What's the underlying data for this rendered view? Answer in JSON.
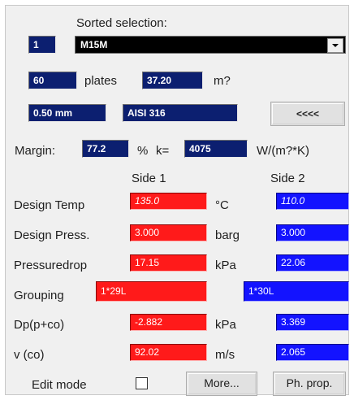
{
  "header": {
    "sorted_selection_label": "Sorted selection:"
  },
  "selection": {
    "index": "1",
    "model": "M15M"
  },
  "plates": {
    "count": "60",
    "label": "plates",
    "area": "37.20",
    "area_unit": "m?"
  },
  "material": {
    "thickness": "0.50 mm",
    "name": "AISI 316",
    "collapse_button": "<<<<"
  },
  "margin": {
    "label": "Margin:",
    "value": "77.2",
    "unit": "%",
    "k_label": "k=",
    "k_value": "4075",
    "k_unit": "W/(m?*K)"
  },
  "columns": {
    "side1": "Side 1",
    "side2": "Side 2"
  },
  "rows": [
    {
      "label": "Design Temp",
      "side1": "135.0",
      "unit": "°C",
      "side2": "110.0"
    },
    {
      "label": "Design Press.",
      "side1": "3.000",
      "unit": "barg",
      "side2": "3.000"
    },
    {
      "label": "Pressuredrop",
      "side1": "17.15",
      "unit": "kPa",
      "side2": "22.06"
    },
    {
      "label": "Grouping",
      "side1": "1*29L",
      "unit": "",
      "side2": "1*30L"
    },
    {
      "label": "Dp(p+co)",
      "side1": "-2.882",
      "unit": "kPa",
      "side2": "3.369"
    },
    {
      "label": "v (co)",
      "side1": "92.02",
      "unit": "m/s",
      "side2": "2.065"
    }
  ],
  "footer": {
    "edit_mode_label": "Edit mode",
    "more_button": "More...",
    "ph_prop_button": "Ph. prop."
  },
  "colors": {
    "navy": "#0c1f70",
    "side1": "#ff1a1a",
    "side2": "#1313ff"
  }
}
